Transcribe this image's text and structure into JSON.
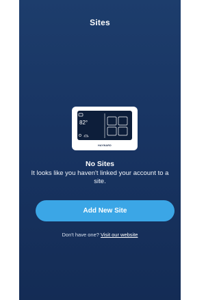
{
  "header": {
    "title": "Sites"
  },
  "illustration": {
    "temperature": "82°",
    "brand": "HAYWARD"
  },
  "empty_state": {
    "title": "No Sites",
    "description": "It looks like you haven't linked your account to a site."
  },
  "actions": {
    "add_site_label": "Add New Site"
  },
  "footer": {
    "prompt": "Don't have one?",
    "link_label": "Visit our website"
  },
  "colors": {
    "background_top": "#1d3d6c",
    "background_bottom": "#142c55",
    "button": "#3ba6e6"
  }
}
